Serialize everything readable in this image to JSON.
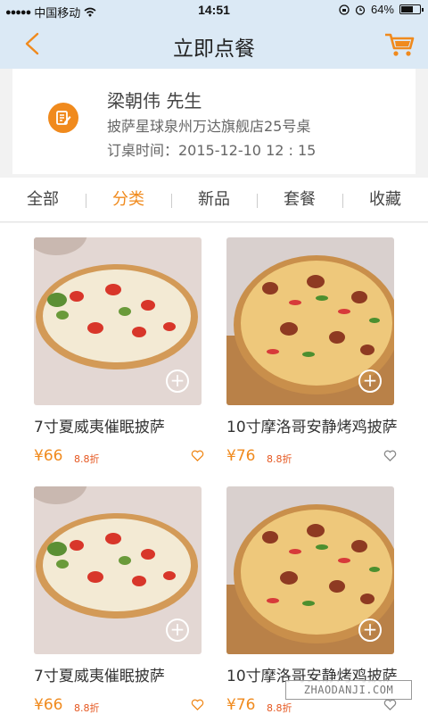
{
  "status_bar": {
    "carrier": "中国移动",
    "time": "14:51",
    "battery": "64%",
    "battery_level": 0.64
  },
  "nav": {
    "title": "立即点餐"
  },
  "order_info": {
    "customer_name": "梁朝伟 先生",
    "store": "披萨星球泉州万达旗舰店25号桌",
    "booking_time": "订桌时间：2015-12-10 12 : 15"
  },
  "tabs": [
    {
      "label": "全部",
      "active": false
    },
    {
      "label": "分类",
      "active": true
    },
    {
      "label": "新品",
      "active": false
    },
    {
      "label": "套餐",
      "active": false
    },
    {
      "label": "收藏",
      "active": false
    }
  ],
  "products": [
    {
      "name": "7寸夏威夷催眠披萨",
      "price": "¥66",
      "discount": "8.8折",
      "image": "pizza-margherita",
      "favorite_color": "#f08a1d"
    },
    {
      "name": "10寸摩洛哥安静烤鸡披萨",
      "price": "¥76",
      "discount": "8.8折",
      "image": "pizza-chicken",
      "favorite_color": "#888888"
    },
    {
      "name": "7寸夏威夷催眠披萨",
      "price": "¥66",
      "discount": "8.8折",
      "image": "pizza-margherita",
      "favorite_color": "#f08a1d"
    },
    {
      "name": "10寸摩洛哥安静烤鸡披萨",
      "price": "¥76",
      "discount": "8.8折",
      "image": "pizza-chicken",
      "favorite_color": "#888888"
    }
  ],
  "watermark": "ZHAODANJI.COM",
  "colors": {
    "accent": "#f08a1d",
    "header_bg": "#dbe9f5",
    "discount": "#e5561f"
  }
}
